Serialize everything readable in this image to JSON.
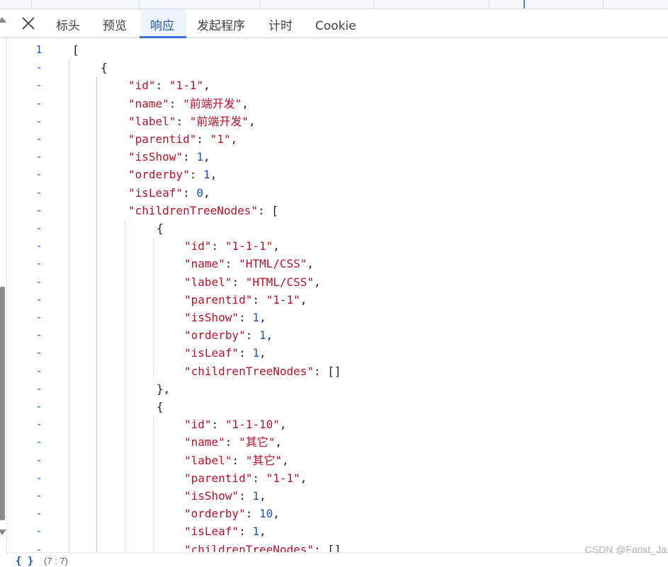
{
  "tabs": [
    {
      "label": "标头"
    },
    {
      "label": "预览"
    },
    {
      "label": "响应",
      "active": true
    },
    {
      "label": "发起程序"
    },
    {
      "label": "计时"
    },
    {
      "label": "Cookie"
    }
  ],
  "colors": {
    "accent": "#3a6fd8",
    "active_tab_text": "#1a55c4",
    "json_key": "#b2142b",
    "json_string": "#b2142b",
    "json_number": "#1a4fbf"
  },
  "icons": {
    "close": "close-icon",
    "fold": "fold-toggle"
  },
  "code": {
    "first_line_number": "1",
    "fold_marker": "-",
    "lines": [
      [
        {
          "t": "[",
          "c": "punc"
        }
      ],
      [
        {
          "t": "{",
          "c": "punc"
        }
      ],
      [
        {
          "t": "\"id\"",
          "c": "key"
        },
        {
          "t": ": ",
          "c": "punc"
        },
        {
          "t": "\"1-1\"",
          "c": "str"
        },
        {
          "t": ",",
          "c": "punc"
        }
      ],
      [
        {
          "t": "\"name\"",
          "c": "key"
        },
        {
          "t": ": ",
          "c": "punc"
        },
        {
          "t": "\"前端开发\"",
          "c": "str"
        },
        {
          "t": ",",
          "c": "punc"
        }
      ],
      [
        {
          "t": "\"label\"",
          "c": "key"
        },
        {
          "t": ": ",
          "c": "punc"
        },
        {
          "t": "\"前端开发\"",
          "c": "str"
        },
        {
          "t": ",",
          "c": "punc"
        }
      ],
      [
        {
          "t": "\"parentid\"",
          "c": "key"
        },
        {
          "t": ": ",
          "c": "punc"
        },
        {
          "t": "\"1\"",
          "c": "str"
        },
        {
          "t": ",",
          "c": "punc"
        }
      ],
      [
        {
          "t": "\"isShow\"",
          "c": "key"
        },
        {
          "t": ": ",
          "c": "punc"
        },
        {
          "t": "1",
          "c": "num"
        },
        {
          "t": ",",
          "c": "punc"
        }
      ],
      [
        {
          "t": "\"orderby\"",
          "c": "key"
        },
        {
          "t": ": ",
          "c": "punc"
        },
        {
          "t": "1",
          "c": "num"
        },
        {
          "t": ",",
          "c": "punc"
        }
      ],
      [
        {
          "t": "\"isLeaf\"",
          "c": "key"
        },
        {
          "t": ": ",
          "c": "punc"
        },
        {
          "t": "0",
          "c": "num"
        },
        {
          "t": ",",
          "c": "punc"
        }
      ],
      [
        {
          "t": "\"childrenTreeNodes\"",
          "c": "key"
        },
        {
          "t": ": [",
          "c": "punc"
        }
      ],
      [
        {
          "t": "{",
          "c": "punc"
        }
      ],
      [
        {
          "t": "\"id\"",
          "c": "key"
        },
        {
          "t": ": ",
          "c": "punc"
        },
        {
          "t": "\"1-1-1\"",
          "c": "str"
        },
        {
          "t": ",",
          "c": "punc"
        }
      ],
      [
        {
          "t": "\"name\"",
          "c": "key"
        },
        {
          "t": ": ",
          "c": "punc"
        },
        {
          "t": "\"HTML/CSS\"",
          "c": "str"
        },
        {
          "t": ",",
          "c": "punc"
        }
      ],
      [
        {
          "t": "\"label\"",
          "c": "key"
        },
        {
          "t": ": ",
          "c": "punc"
        },
        {
          "t": "\"HTML/CSS\"",
          "c": "str"
        },
        {
          "t": ",",
          "c": "punc"
        }
      ],
      [
        {
          "t": "\"parentid\"",
          "c": "key"
        },
        {
          "t": ": ",
          "c": "punc"
        },
        {
          "t": "\"1-1\"",
          "c": "str"
        },
        {
          "t": ",",
          "c": "punc"
        }
      ],
      [
        {
          "t": "\"isShow\"",
          "c": "key"
        },
        {
          "t": ": ",
          "c": "punc"
        },
        {
          "t": "1",
          "c": "num"
        },
        {
          "t": ",",
          "c": "punc"
        }
      ],
      [
        {
          "t": "\"orderby\"",
          "c": "key"
        },
        {
          "t": ": ",
          "c": "punc"
        },
        {
          "t": "1",
          "c": "num"
        },
        {
          "t": ",",
          "c": "punc"
        }
      ],
      [
        {
          "t": "\"isLeaf\"",
          "c": "key"
        },
        {
          "t": ": ",
          "c": "punc"
        },
        {
          "t": "1",
          "c": "num"
        },
        {
          "t": ",",
          "c": "punc"
        }
      ],
      [
        {
          "t": "\"childrenTreeNodes\"",
          "c": "key"
        },
        {
          "t": ": []",
          "c": "punc"
        }
      ],
      [
        {
          "t": "},",
          "c": "punc"
        }
      ],
      [
        {
          "t": "{",
          "c": "punc"
        }
      ],
      [
        {
          "t": "\"id\"",
          "c": "key"
        },
        {
          "t": ": ",
          "c": "punc"
        },
        {
          "t": "\"1-1-10\"",
          "c": "str"
        },
        {
          "t": ",",
          "c": "punc"
        }
      ],
      [
        {
          "t": "\"name\"",
          "c": "key"
        },
        {
          "t": ": ",
          "c": "punc"
        },
        {
          "t": "\"其它\"",
          "c": "str"
        },
        {
          "t": ",",
          "c": "punc"
        }
      ],
      [
        {
          "t": "\"label\"",
          "c": "key"
        },
        {
          "t": ": ",
          "c": "punc"
        },
        {
          "t": "\"其它\"",
          "c": "str"
        },
        {
          "t": ",",
          "c": "punc"
        }
      ],
      [
        {
          "t": "\"parentid\"",
          "c": "key"
        },
        {
          "t": ": ",
          "c": "punc"
        },
        {
          "t": "\"1-1\"",
          "c": "str"
        },
        {
          "t": ",",
          "c": "punc"
        }
      ],
      [
        {
          "t": "\"isShow\"",
          "c": "key"
        },
        {
          "t": ": ",
          "c": "punc"
        },
        {
          "t": "1",
          "c": "num"
        },
        {
          "t": ",",
          "c": "punc"
        }
      ],
      [
        {
          "t": "\"orderby\"",
          "c": "key"
        },
        {
          "t": ": ",
          "c": "punc"
        },
        {
          "t": "10",
          "c": "num"
        },
        {
          "t": ",",
          "c": "punc"
        }
      ],
      [
        {
          "t": "\"isLeaf\"",
          "c": "key"
        },
        {
          "t": ": ",
          "c": "punc"
        },
        {
          "t": "1",
          "c": "num"
        },
        {
          "t": ",",
          "c": "punc"
        }
      ],
      [
        {
          "t": "\"childrenTreeNodes\"",
          "c": "key"
        },
        {
          "t": ": []",
          "c": "punc"
        }
      ]
    ]
  },
  "status": {
    "brace": "{ }",
    "info": "(7 : 7)"
  },
  "watermark": "CSDN @Fanxt_Ja"
}
